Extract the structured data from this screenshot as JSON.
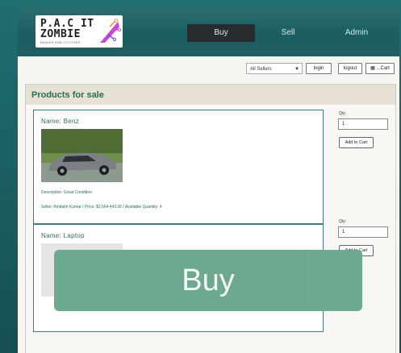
{
  "brand": {
    "line1": "P.A.C IT",
    "line2": "ZOMBIE",
    "line3": "BRAINS AND CLOTHES"
  },
  "nav": {
    "buy": "Buy",
    "sell": "Sell",
    "admin": "Admin"
  },
  "toolbar": {
    "seller_filter": "All Sellers",
    "login": "login",
    "logout": "logout",
    "cart": "...Cart"
  },
  "panel": {
    "title": "Products for sale"
  },
  "products": [
    {
      "name": "Name: Benz",
      "description": "Description: Great Condition",
      "seller_line": "Seller: Amitabh Kumar / Price: $2,564,443.00 / Available Quantity: 4",
      "qty_label": "Qty:",
      "qty_value": "1",
      "add_label": "Add to Cart"
    },
    {
      "name": "Name: Laptop",
      "qty_label": "Qty:",
      "qty_value": "1",
      "add_label": "Add to Cart"
    }
  ],
  "overlay": {
    "label": "Buy",
    "color": "#6ba88f"
  },
  "colors": {
    "accent_teal": "#1b5d61",
    "nav_active": "#272c2f",
    "title_green": "#2a6b55"
  }
}
